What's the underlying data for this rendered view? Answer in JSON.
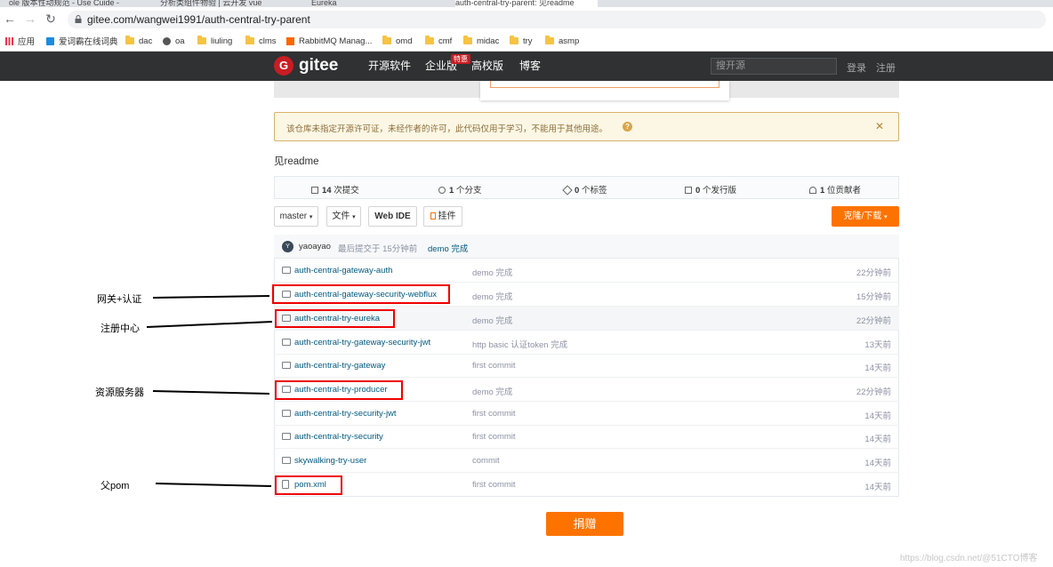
{
  "browser": {
    "tabs": [
      {
        "label": "ole 版本性动规范 - Use Cuide -"
      },
      {
        "label": "分析类组件物验 | 云开发 vue"
      },
      {
        "label": "Eureka"
      },
      {
        "label": "auth-central-try-parent: 见readme"
      }
    ],
    "url": "gitee.com/wangwei1991/auth-central-try-parent",
    "bookmarks": [
      "应用",
      "爱词霸在线词典",
      "dac",
      "oa",
      "liuling",
      "clms",
      "RabbitMQ Manag...",
      "omd",
      "cmf",
      "midac",
      "try",
      "asmp"
    ]
  },
  "gitee_nav": {
    "logo_text": "gitee",
    "logo_mark": "G",
    "links": [
      "开源软件",
      "企业版",
      "高校版",
      "博客"
    ],
    "badge": "特惠",
    "search_placeholder": "搜开源",
    "login": "登录",
    "register": "注册"
  },
  "notice": {
    "text": "该仓库未指定开源许可证，未经作者的许可，此代码仅用于学习，不能用于其他用途。",
    "help_icon": "?",
    "close_icon": "✕"
  },
  "description": "见readme",
  "stats": [
    {
      "count": "14",
      "label": "次提交",
      "icon": "commit-icon"
    },
    {
      "count": "1",
      "label": "个分支",
      "icon": "branch-icon"
    },
    {
      "count": "0",
      "label": "个标签",
      "icon": "tag-icon"
    },
    {
      "count": "0",
      "label": "个发行版",
      "icon": "release-icon"
    },
    {
      "count": "1",
      "label": "位贡献者",
      "icon": "contributor-icon"
    }
  ],
  "toolbar": {
    "branch": "master",
    "files": "文件",
    "webide": "Web IDE",
    "pendant": "挂件",
    "clone": "克隆/下载"
  },
  "last_commit": {
    "avatar": "Y",
    "author": "yaoayao",
    "info": "最后提交于 15分钟前",
    "message": "demo 完成"
  },
  "files": [
    {
      "name": "auth-central-gateway-auth",
      "type": "folder",
      "message": "demo 完成",
      "time": "22分钟前"
    },
    {
      "name": "auth-central-gateway-security-webflux",
      "type": "folder",
      "message": "demo 完成",
      "time": "15分钟前"
    },
    {
      "name": "auth-central-try-eureka",
      "type": "folder",
      "message": "demo 完成",
      "time": "22分钟前"
    },
    {
      "name": "auth-central-try-gateway-security-jwt",
      "type": "folder",
      "message": "http basic 认证token 完成",
      "time": "13天前"
    },
    {
      "name": "auth-central-try-gateway",
      "type": "folder",
      "message": "first commit",
      "time": "14天前"
    },
    {
      "name": "auth-central-try-producer",
      "type": "folder",
      "message": "demo 完成",
      "time": "22分钟前"
    },
    {
      "name": "auth-central-try-security-jwt",
      "type": "folder",
      "message": "first commit",
      "time": "14天前"
    },
    {
      "name": "auth-central-try-security",
      "type": "folder",
      "message": "first commit",
      "time": "14天前"
    },
    {
      "name": "skywalking-try-user",
      "type": "folder",
      "message": "commit",
      "time": "14天前"
    },
    {
      "name": "pom.xml",
      "type": "file",
      "message": "first commit",
      "time": "14天前"
    }
  ],
  "annotations": [
    "网关+认证",
    "注册中心",
    "资源服务器",
    "父pom"
  ],
  "donate": "捐赠",
  "watermark": "https://blog.csdn.net/@51CTO博客",
  "colors": {
    "gitee_red": "#c71d23",
    "orange": "#fe7300",
    "nav_bg": "#2f3133",
    "link": "#005980",
    "annotation_box": "#ee0000"
  }
}
